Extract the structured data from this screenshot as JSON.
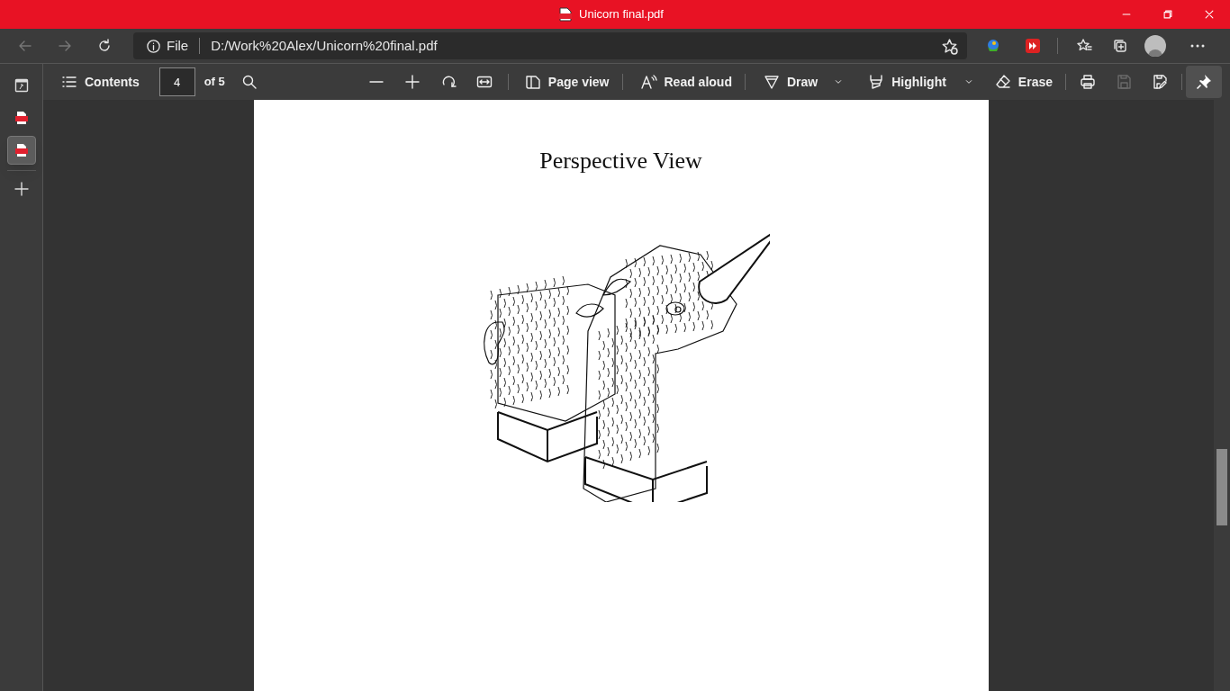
{
  "window": {
    "title": "Unicorn final.pdf"
  },
  "address_bar": {
    "site_label": "File",
    "url": "D:/Work%20Alex/Unicorn%20final.pdf"
  },
  "vertical_tabs": [
    {
      "kind": "app",
      "selected": false
    },
    {
      "kind": "pdf",
      "selected": false
    },
    {
      "kind": "pdf",
      "selected": true
    }
  ],
  "pdf_toolbar": {
    "contents": "Contents",
    "page": "4",
    "page_count": "of 5",
    "page_view": "Page view",
    "read_aloud": "Read aloud",
    "draw": "Draw",
    "highlight": "Highlight",
    "erase": "Erase",
    "save_disabled": true,
    "pin_selected": true
  },
  "page": {
    "heading": "Perspective View"
  }
}
